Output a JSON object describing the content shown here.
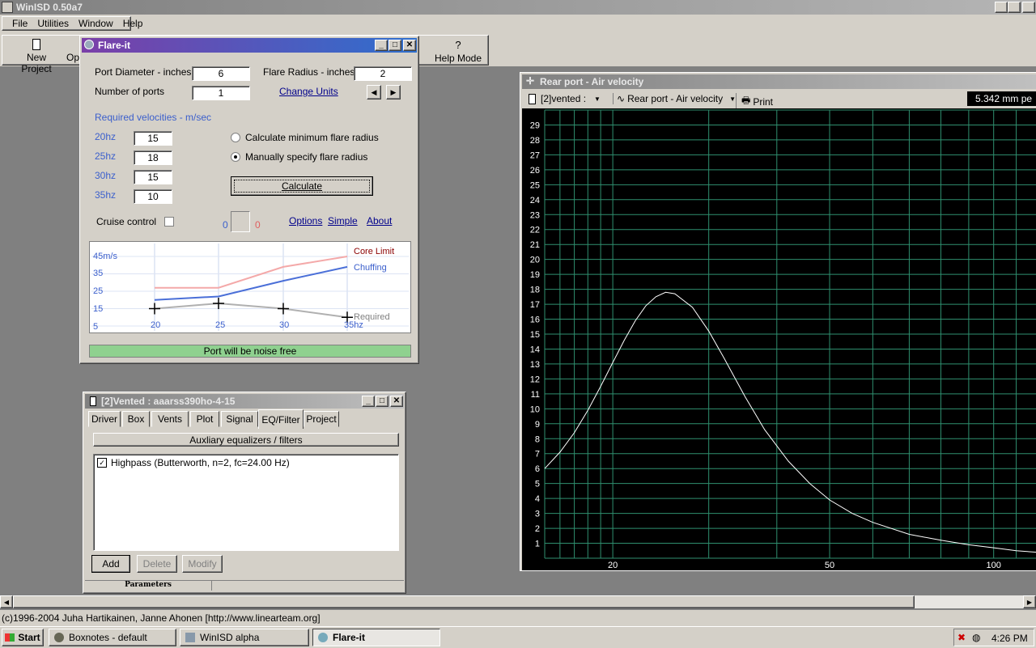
{
  "app": {
    "title": "WinISD 0.50a7",
    "menu": [
      "File",
      "Utilities",
      "Window",
      "Help"
    ],
    "toolbar": {
      "new_project": "New Project",
      "open": "Op",
      "help_mode": "Help Mode",
      "help_mode_icon_text": "?"
    },
    "status_text": "(c)1996-2004 Juha Hartikainen, Janne Ahonen [http://www.linearteam.org]"
  },
  "flare": {
    "title": "Flare-it",
    "port_diameter_label": "Port Diameter - inches",
    "port_diameter_value": "6",
    "flare_radius_label": "Flare Radius - inches",
    "flare_radius_value": "2",
    "num_ports_label": "Number of ports",
    "num_ports_value": "1",
    "change_units": "Change Units",
    "velocities_label": "Required velocities - m/sec",
    "velocities": [
      {
        "label": "20hz",
        "value": "15"
      },
      {
        "label": "25hz",
        "value": "18"
      },
      {
        "label": "30hz",
        "value": "15"
      },
      {
        "label": "35hz",
        "value": "10"
      }
    ],
    "radio_min": "Calculate minimum flare radius",
    "radio_manual": "Manually specify flare radius",
    "calculate": "Calculate",
    "cruise_control": "Cruise control",
    "counter_left": "0",
    "counter_right": "0",
    "options": "Options",
    "simple": "Simple",
    "about": "About",
    "mini_chart": {
      "y_labels": [
        "45m/s",
        "35",
        "25",
        "15",
        "5"
      ],
      "x_labels": [
        "20",
        "25",
        "30",
        "35hz"
      ],
      "core_limit_label": "Core Limit",
      "chuffing_label": "Chuffing",
      "required_label": "Required",
      "core_limit": [
        27,
        27,
        39,
        45
      ],
      "chuffing": [
        20,
        22,
        31,
        39
      ],
      "required": [
        15,
        18,
        15,
        10
      ]
    },
    "status": "Port will be noise free"
  },
  "vented": {
    "title": "[2]Vented : aaarss390ho-4-15",
    "tabs": [
      "Driver",
      "Box",
      "Vents",
      "Plot",
      "Signal",
      "EQ/Filter",
      "Project"
    ],
    "active_tab": "EQ/Filter",
    "aux_button": "Auxliary equalizers / filters",
    "filter_item": "Highpass (Butterworth, n=2, fc=24.00 Hz)",
    "add": "Add",
    "delete": "Delete",
    "modify": "Modify",
    "status_tab": "Parameters"
  },
  "plot": {
    "title": "Rear port - Air velocity",
    "project_select": "[2]vented :",
    "graph_select": "Rear port - Air velocity",
    "print": "Print",
    "readout": "5.342 mm pe",
    "y_ticks": [
      "1",
      "2",
      "3",
      "4",
      "5",
      "6",
      "7",
      "8",
      "9",
      "10",
      "11",
      "12",
      "13",
      "14",
      "15",
      "16",
      "17",
      "18",
      "19",
      "20",
      "21",
      "22",
      "23",
      "24",
      "25",
      "26",
      "27",
      "28",
      "29"
    ],
    "x_ticks": [
      "20",
      "50",
      "100"
    ],
    "colors": {
      "background": "#000000",
      "grid": "#2f8f6f",
      "curve": "#ffffff"
    }
  },
  "chart_data": {
    "type": "line",
    "title": "Rear port - Air velocity",
    "xscale": "log",
    "xlim": [
      15,
      120
    ],
    "ylim": [
      0,
      30
    ],
    "x": [
      15,
      16,
      17,
      18,
      19,
      20,
      21,
      22,
      23,
      24,
      25,
      26,
      28,
      30,
      32,
      35,
      38,
      42,
      46,
      50,
      55,
      60,
      70,
      80,
      90,
      100,
      110,
      120
    ],
    "series": [
      {
        "values": [
          6.0,
          7.1,
          8.4,
          9.9,
          11.5,
          13.1,
          14.6,
          15.9,
          16.9,
          17.5,
          17.8,
          17.7,
          16.8,
          15.2,
          13.4,
          10.8,
          8.6,
          6.5,
          5.0,
          3.9,
          3.0,
          2.4,
          1.6,
          1.2,
          0.9,
          0.7,
          0.5,
          0.4
        ]
      }
    ],
    "grid": true
  },
  "taskbar": {
    "start": "Start",
    "items": [
      "Boxnotes - default",
      "WinISD alpha",
      "Flare-it"
    ],
    "clock": "4:26 PM"
  }
}
